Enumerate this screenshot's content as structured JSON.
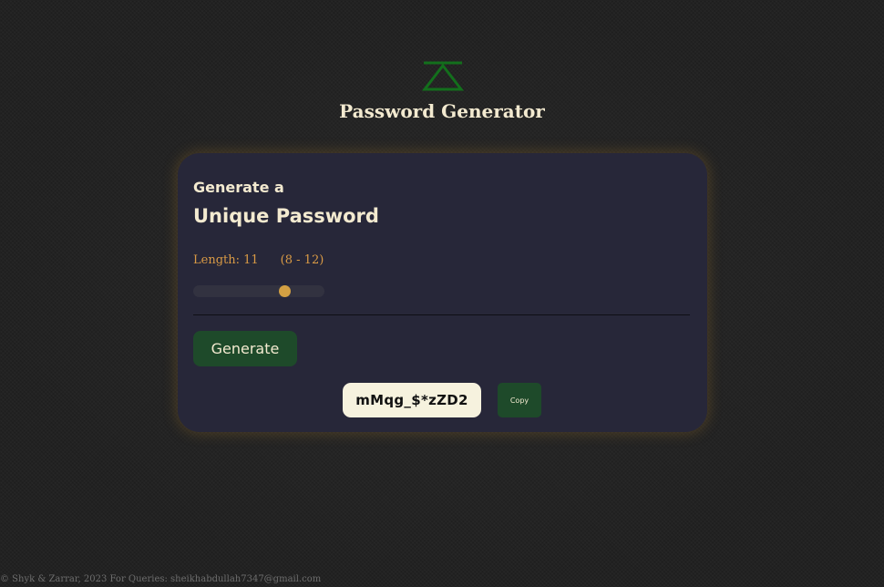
{
  "header": {
    "logo_icon": "delta-triangle-logo-icon",
    "logo_color": "#136f1c",
    "title": "Password Generator"
  },
  "card": {
    "eyebrow": "Generate a",
    "headline": "Unique Password",
    "length_label": "Length: 11",
    "length_range": "(8 - 12)",
    "slider": {
      "min": 8,
      "max": 12,
      "value": 11
    },
    "generate_label": "Generate",
    "password": "mMqg_$*zZD2",
    "copy_label": "Copy"
  },
  "footer": {
    "text": "© Shyk & Zarrar, 2023 For Queries: sheikhabdullah7347@gmail.com"
  },
  "colors": {
    "accent_green": "#1e4a2a",
    "accent_orange": "#d99a45",
    "card_bg": "#272739",
    "text_cream": "#f3ead0"
  }
}
